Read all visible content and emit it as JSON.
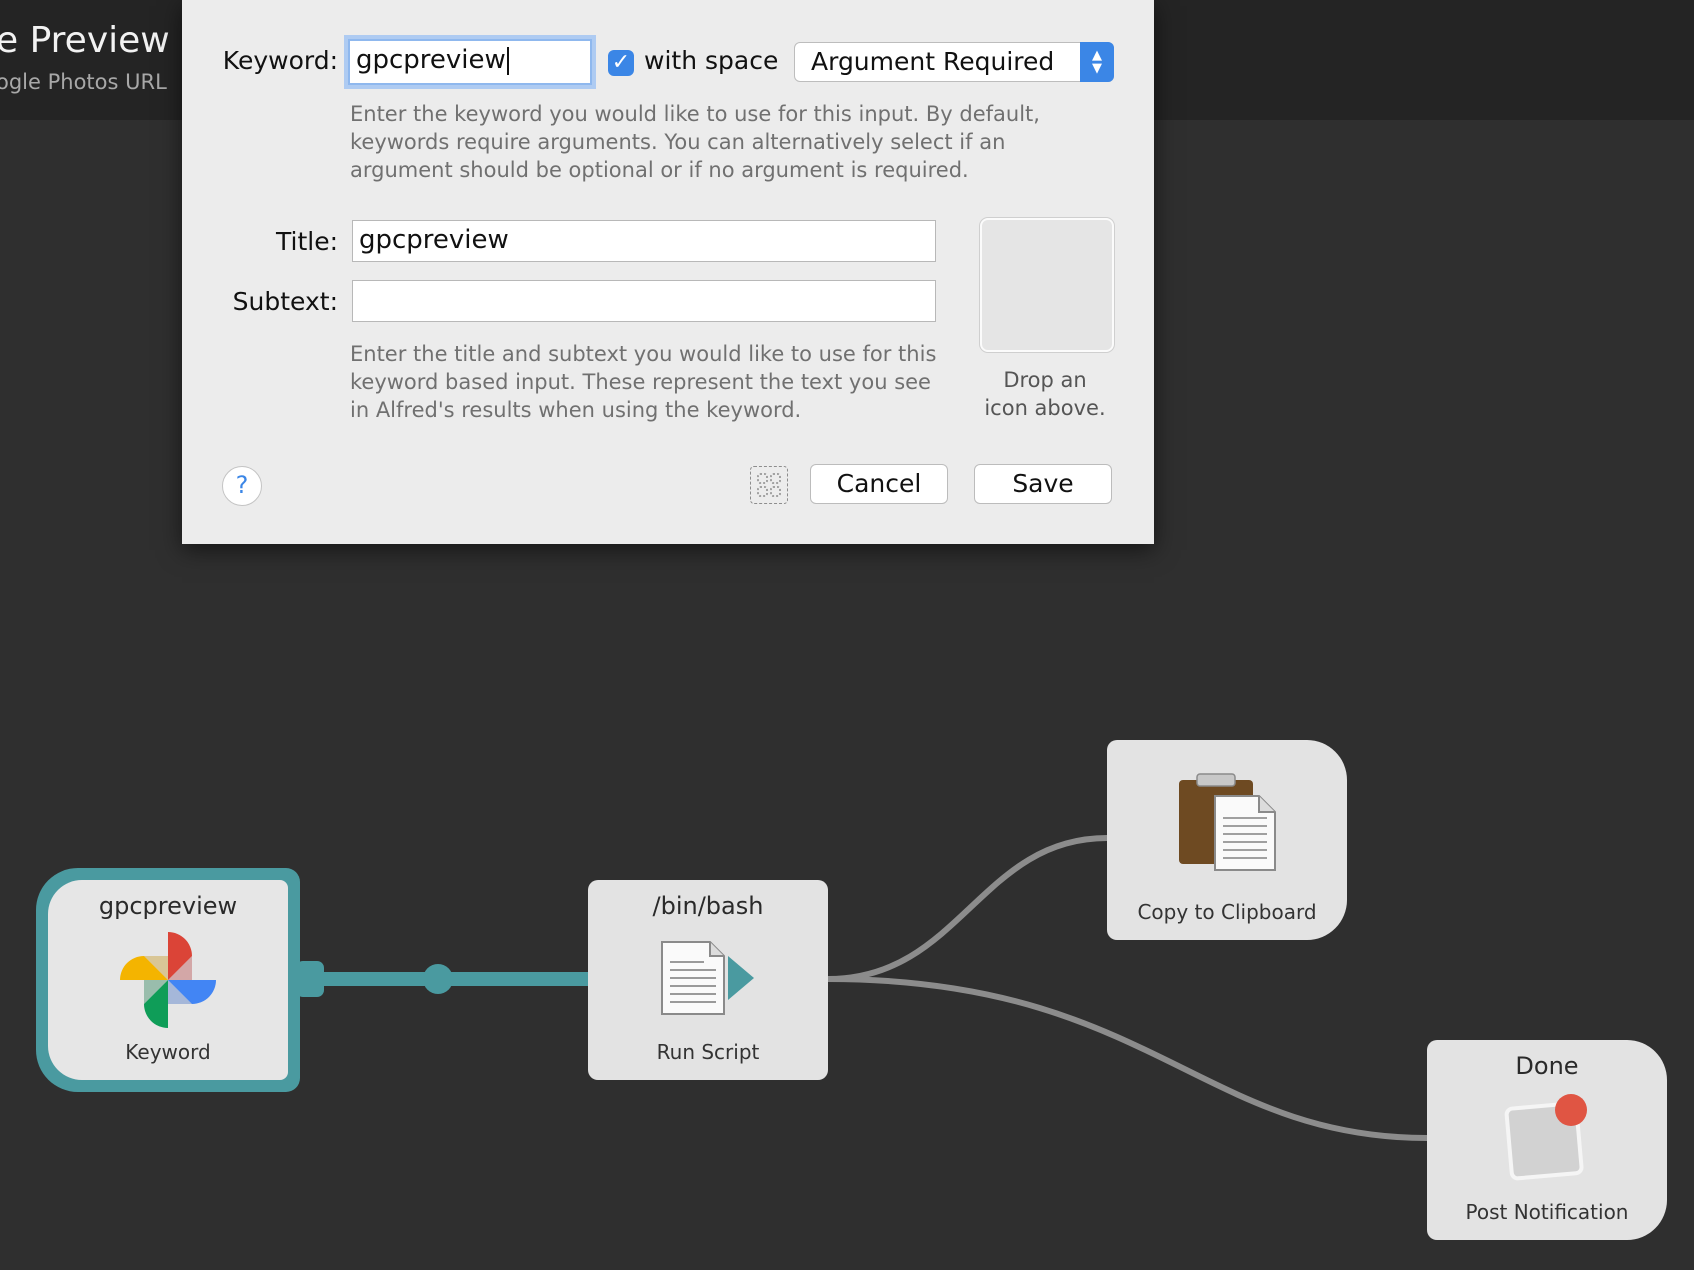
{
  "header": {
    "title": "e Preview",
    "subtitle": "ogle Photos URL"
  },
  "dialog": {
    "keyword_label": "Keyword:",
    "keyword_value": "gpcpreview",
    "with_space_label": "with space",
    "with_space_checked": true,
    "argument_select_value": "Argument Required",
    "keyword_help": [
      "Enter the keyword you would like to use for this input. By default,",
      "keywords require arguments. You can alternatively select if an",
      "argument should be optional or if no argument is required."
    ],
    "title_label": "Title:",
    "title_value": "gpcpreview",
    "subtext_label": "Subtext:",
    "subtext_value": "",
    "title_help": [
      "Enter the title and subtext you would like to use for this",
      "keyword based input. These represent the text you see",
      "in Alfred's results when using the keyword."
    ],
    "icon_hint": [
      "Drop an",
      "icon above."
    ],
    "help_button": "?",
    "cancel_button": "Cancel",
    "save_button": "Save"
  },
  "nodes": {
    "keyword": {
      "title": "gpcpreview",
      "label": "Keyword"
    },
    "script": {
      "title": "/bin/bash",
      "label": "Run Script"
    },
    "clipboard": {
      "label": "Copy to Clipboard"
    },
    "notification": {
      "title": "Done",
      "label": "Post Notification"
    }
  },
  "colors": {
    "accent": "#3b86e6",
    "wire_selected": "#4a9aa0",
    "wire": "#8c8c8c",
    "canvas": "#2f2f2f"
  }
}
